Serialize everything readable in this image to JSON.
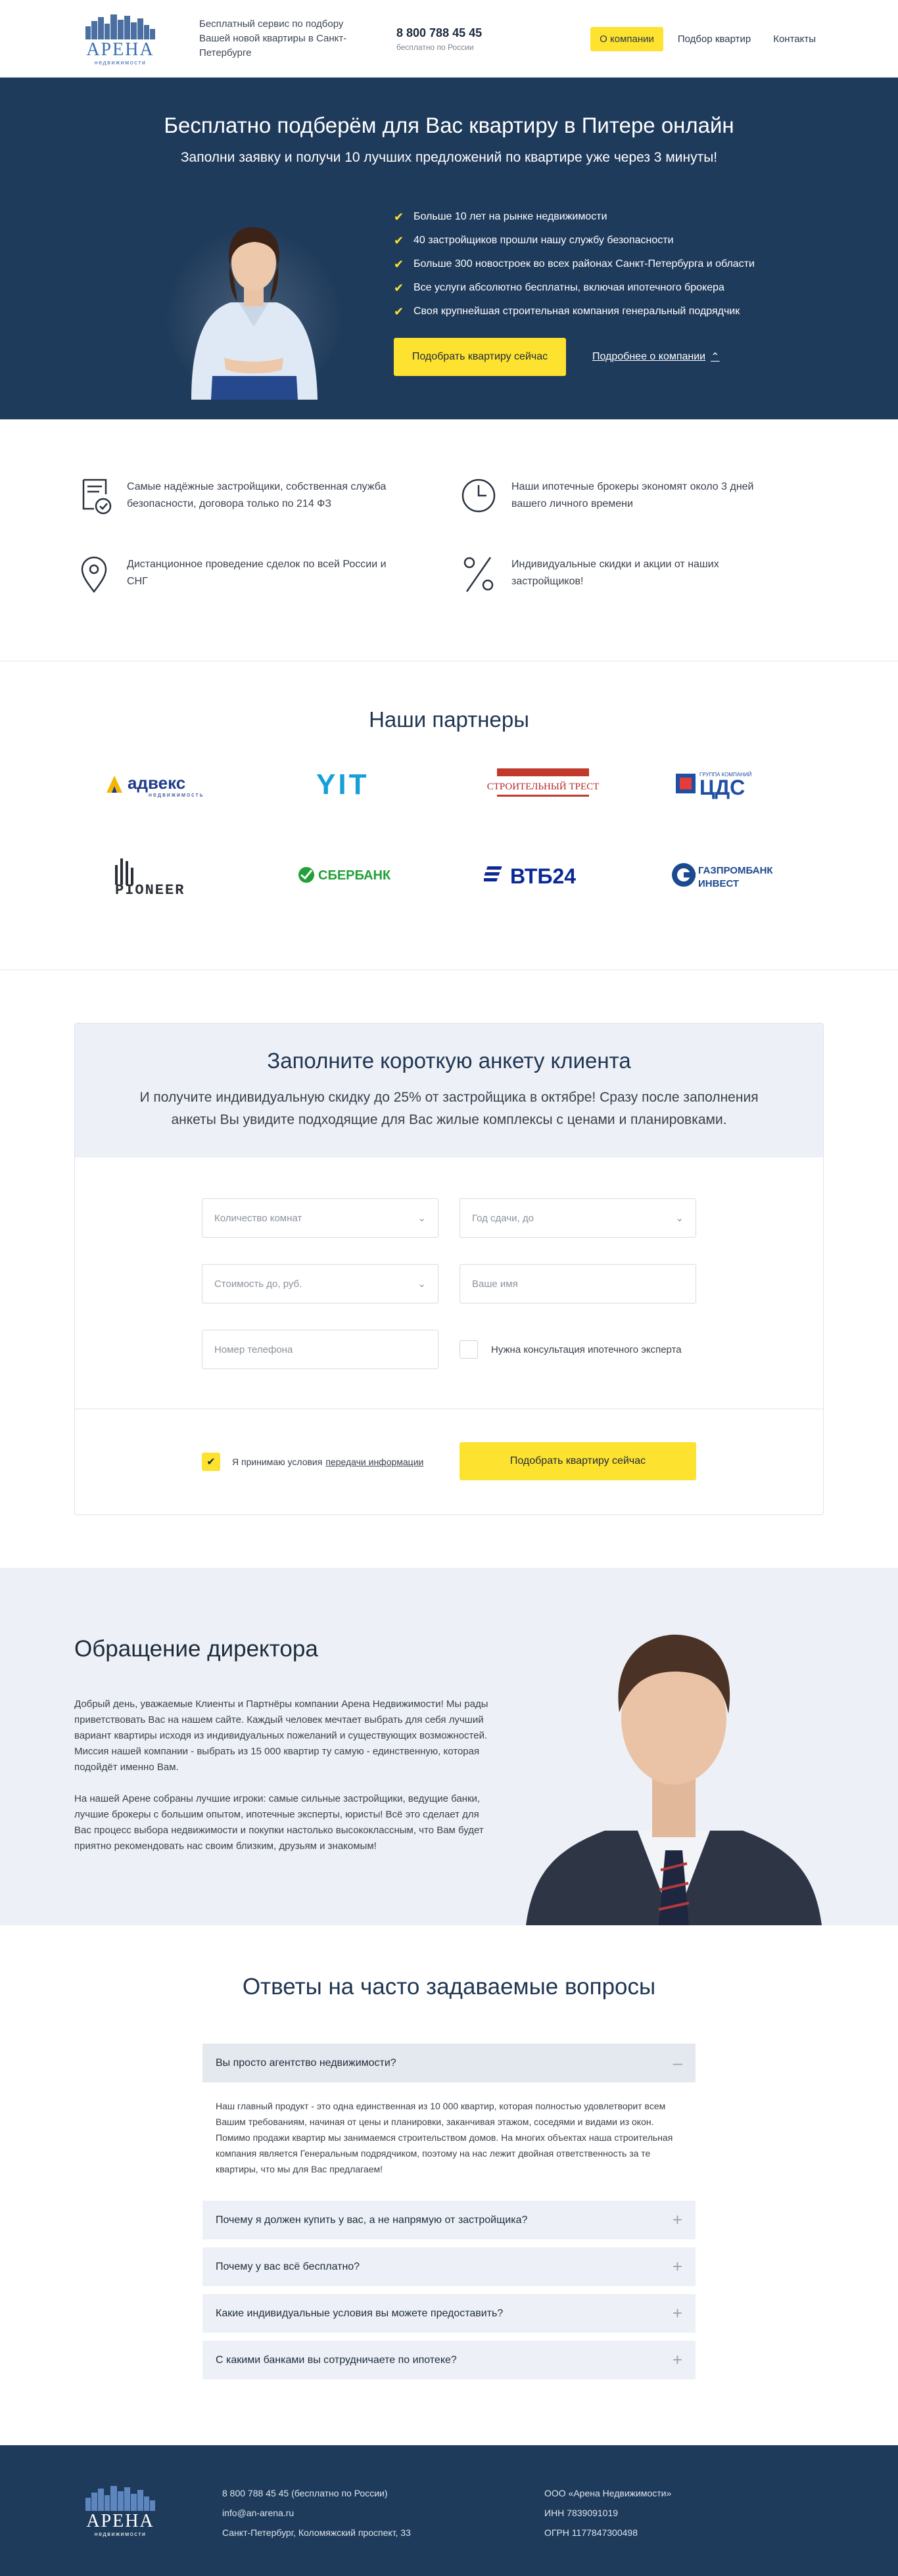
{
  "header": {
    "logo_text": "АРЕНА",
    "logo_sub": "недвижимости",
    "tagline": "Бесплатный сервис по подбору Вашей новой квартиры в Санкт-Петербурге",
    "phone": "8 800 788 45 45",
    "phone_note": "бесплатно по России",
    "nav": [
      "О компании",
      "Подбор квартир",
      "Контакты"
    ]
  },
  "hero": {
    "title": "Бесплатно подберём для Вас квартиру в Питере онлайн",
    "lead": "Заполни заявку и получи 10 лучших предложений по квартире уже через 3 минуты!",
    "benefits": [
      "Больше 10 лет на рынке недвижимости",
      "40 застройщиков прошли нашу службу безопасности",
      "Больше 300 новостроек во всех районах Санкт-Петербурга и области",
      "Все услуги абсолютно бесплатны, включая ипотечного брокера",
      "Своя крупнейшая строительная компания генеральный подрядчик"
    ],
    "cta": "Подобрать квартиру сейчас",
    "more": "Подробнее о компании"
  },
  "features": [
    {
      "icon": "shield-doc-icon",
      "text": "Самые надёжные застройщики, собственная служба безопасности, договора только по 214 ФЗ"
    },
    {
      "icon": "clock-icon",
      "text": "Наши ипотечные брокеры экономят около 3 дней вашего личного времени"
    },
    {
      "icon": "location-pin-icon",
      "text": "Дистанционное проведение сделок по всей России и СНГ"
    },
    {
      "icon": "percent-icon",
      "text": "Индивидуальные скидки и акции от наших застройщиков!"
    }
  ],
  "partners": {
    "title": "Наши партнеры",
    "logos": [
      {
        "name": "адвекс",
        "sub": "недвижимость"
      },
      {
        "name": "YIT"
      },
      {
        "name": "СТРОИТЕЛЬНЫЙ ТРЕСТ"
      },
      {
        "name": "ЦДС",
        "sub": "ГРУППА КОМПАНИЙ"
      },
      {
        "name": "PIONEER"
      },
      {
        "name": "СБЕРБАНК"
      },
      {
        "name": "ВТБ24"
      },
      {
        "name": "ГАЗПРОМБАНК",
        "sub": "ИНВЕСТ"
      }
    ]
  },
  "form": {
    "title": "Заполните короткую анкету клиента",
    "subtitle": "И получите индивидуальную скидку до 25% от застройщика в октябре! Сразу после заполнения анкеты Вы увидите подходящие для Вас жилые комплексы с ценами и планировками.",
    "rooms_placeholder": "Количество комнат",
    "date_placeholder": "Год сдачи, до",
    "price_placeholder": "Стоимость до, руб.",
    "name_placeholder": "Ваше имя",
    "phone_placeholder": "Номер телефона",
    "mortgage_label": "Нужна консультация ипотечного эксперта",
    "agree_text": "Я принимаю условия",
    "agree_link": "передачи информации",
    "submit": "Подобрать квартиру сейчас"
  },
  "director": {
    "title": "Обращение директора",
    "p1": "Добрый день, уважаемые Клиенты и Партнёры компании Арена Недвижимости! Мы рады приветствовать Вас на нашем сайте. Каждый человек мечтает выбрать для себя лучший вариант квартиры исходя из индивидуальных пожеланий и существующих возможностей. Миссия нашей компании - выбрать из 15 000 квартир ту самую - единственную, которая подойдёт именно Вам.",
    "p2": "На нашей Арене собраны лучшие игроки: самые сильные застройщики, ведущие банки, лучшие брокеры с большим опытом, ипотечные эксперты, юристы! Всё это сделает для Вас процесс выбора недвижимости и покупки настолько высококлассным, что Вам будет приятно рекомендовать нас своим близким, друзьям и знакомым!"
  },
  "faq": {
    "title": "Ответы на часто задаваемые вопросы",
    "items": [
      {
        "q": "Вы просто агентство недвижимости?",
        "a": "Наш главный продукт - это одна единственная из 10 000 квартир, которая полностью удовлетворит всем Вашим требованиям, начиная от цены и планировки, заканчивая этажом, соседями и видами из окон. Помимо продажи квартир мы занимаемся строительством домов. На многих объектах наша строительная компания является Генеральным подрядчиком, поэтому на нас лежит двойная ответственность за те квартиры, что мы для Вас предлагаем!"
      },
      {
        "q": "Почему я должен купить у вас, а не напрямую от застройщика?"
      },
      {
        "q": "Почему у вас всё бесплатно?"
      },
      {
        "q": "Какие индивидуальные условия вы можете предоставить?"
      },
      {
        "q": "С какими банками вы сотрудничаете по ипотеке?"
      }
    ]
  },
  "footer": {
    "phone": "8 800 788 45 45 (бесплатно по России)",
    "email": "info@an-arena.ru",
    "address": "Санкт-Петербург, Коломяжский проспект, 33",
    "company": "ООО «Арена Недвижимости»",
    "inn": "ИНН 7839091019",
    "ogrn": "ОГРН 1177847300498"
  },
  "colors": {
    "navy": "#1f3b5b",
    "yellow": "#fde22f",
    "light": "#edf1f7"
  }
}
